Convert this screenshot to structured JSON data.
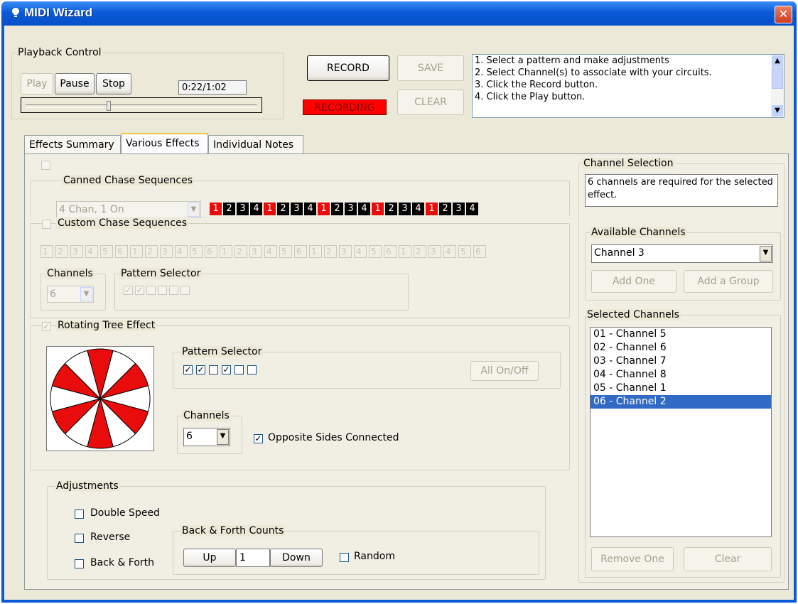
{
  "window": {
    "title": "MIDI Wizard"
  },
  "playback": {
    "group_label": "Playback Control",
    "play_label": "Play",
    "pause_label": "Pause",
    "stop_label": "Stop",
    "time": "0:22/1:02",
    "progress": 0.35
  },
  "record": {
    "record_label": "RECORD",
    "save_label": "SAVE",
    "clear_label": "CLEAR",
    "recording_status": "RECORDING"
  },
  "instructions": [
    "1. Select a pattern and make adjustments",
    "2. Select Channel(s) to associate with your circuits.",
    "3. Click the Record button.",
    "4. Click the Play button."
  ],
  "tabs": [
    {
      "label": "Effects Summary"
    },
    {
      "label": "Various Effects"
    },
    {
      "label": "Individual Notes"
    }
  ],
  "canned": {
    "label": "Canned  Chase Sequences",
    "combo_value": "4 Chan, 1 On",
    "sequence": [
      "1",
      "2",
      "3",
      "4",
      "1",
      "2",
      "3",
      "4",
      "1",
      "2",
      "3",
      "4",
      "1",
      "2",
      "3",
      "4",
      "1",
      "2",
      "3",
      "4"
    ]
  },
  "custom": {
    "label": "Custom Chase Sequences",
    "sequence": [
      "1",
      "2",
      "3",
      "4",
      "5",
      "6",
      "1",
      "2",
      "3",
      "4",
      "5",
      "6",
      "1",
      "2",
      "3",
      "4",
      "5",
      "6",
      "1",
      "2",
      "3",
      "4",
      "5",
      "6",
      "1",
      "2",
      "3",
      "4",
      "5",
      "6"
    ],
    "channels_label": "Channels",
    "channels_value": "6",
    "pattern_label": "Pattern Selector"
  },
  "rotating": {
    "label": "Rotating Tree Effect",
    "pattern_label": "Pattern Selector",
    "all_onoff_label": "All On/Off",
    "channels_label": "Channels",
    "channels_value": "6",
    "opposite_label": "Opposite Sides  Connected",
    "wheel_colors": {
      "on": "#e80c0c",
      "off": "#ffffff"
    }
  },
  "adjustments": {
    "label": "Adjustments",
    "double_speed": "Double Speed",
    "reverse": "Reverse",
    "back_forth": "Back & Forth",
    "counts_label": "Back & Forth Counts",
    "up_label": "Up",
    "count_value": "1",
    "down_label": "Down",
    "random_label": "Random"
  },
  "channel_selection": {
    "label": "Channel Selection",
    "message": "6 channels are required for the selected effect.",
    "available_label": "Available Channels",
    "available_value": "Channel 3",
    "add_one_label": "Add One",
    "add_group_label": "Add a Group",
    "selected_label": "Selected Channels",
    "selected_items": [
      "01 - Channel 5",
      "02 - Channel 6",
      "03 - Channel 7",
      "04 - Channel 8",
      "05 - Channel 1",
      "06 - Channel 2"
    ],
    "remove_one_label": "Remove One",
    "clear_label": "Clear"
  }
}
